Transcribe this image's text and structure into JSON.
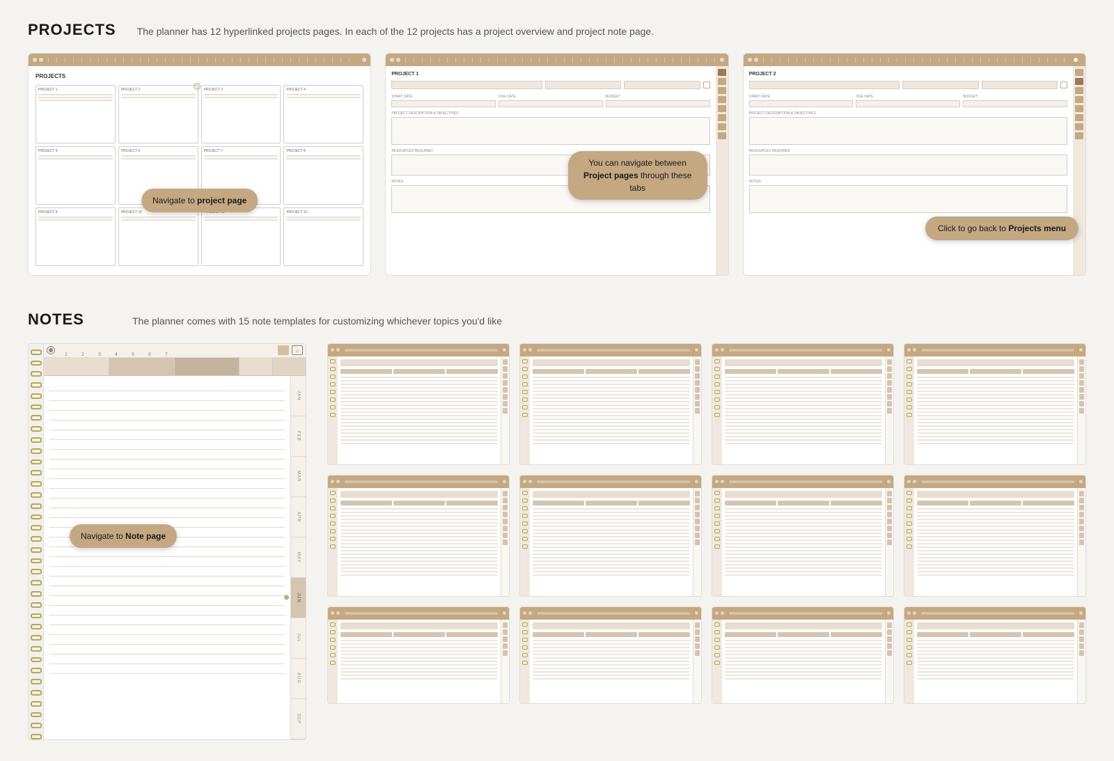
{
  "projects": {
    "title": "PROJECTS",
    "description": "The planner has 12 hyperlinked projects pages. In each of the 12 projects has a project overview and project note page.",
    "screenshots": [
      {
        "id": "proj-menu",
        "label": "PROJECTS",
        "tooltip": "Navigate to project page",
        "tooltip_position": "center"
      },
      {
        "id": "proj-1",
        "label": "PROJECT 1",
        "tooltip": "You can navigate between Project pages through these tabs",
        "tooltip_position": "center"
      },
      {
        "id": "proj-2",
        "label": "PROJECT 2",
        "tooltip": "Click to go back to Projects menu",
        "tooltip_position": "right"
      }
    ]
  },
  "notes": {
    "title": "NOTES",
    "description": "The planner comes with 15 note templates for customizing whichever topics you'd like",
    "left_planner": {
      "tooltip": "Navigate to Note page",
      "ruler_numbers": [
        "1",
        "2",
        "3",
        "4",
        "5",
        "6",
        "7"
      ],
      "month_tabs": [
        "JAN",
        "FEB",
        "MAR",
        "APR",
        "MAY",
        "JUN",
        "JUL",
        "AUG",
        "SEP"
      ],
      "active_month": "JUN"
    },
    "template_count": 12
  },
  "colors": {
    "tan": "#c4a882",
    "dark_tan": "#a07850",
    "light_tan": "#e8ddd0",
    "gold_ring": "#b8a84a",
    "text_dark": "#1a1a1a",
    "text_mid": "#555",
    "bg_main": "#f5f3ef"
  }
}
